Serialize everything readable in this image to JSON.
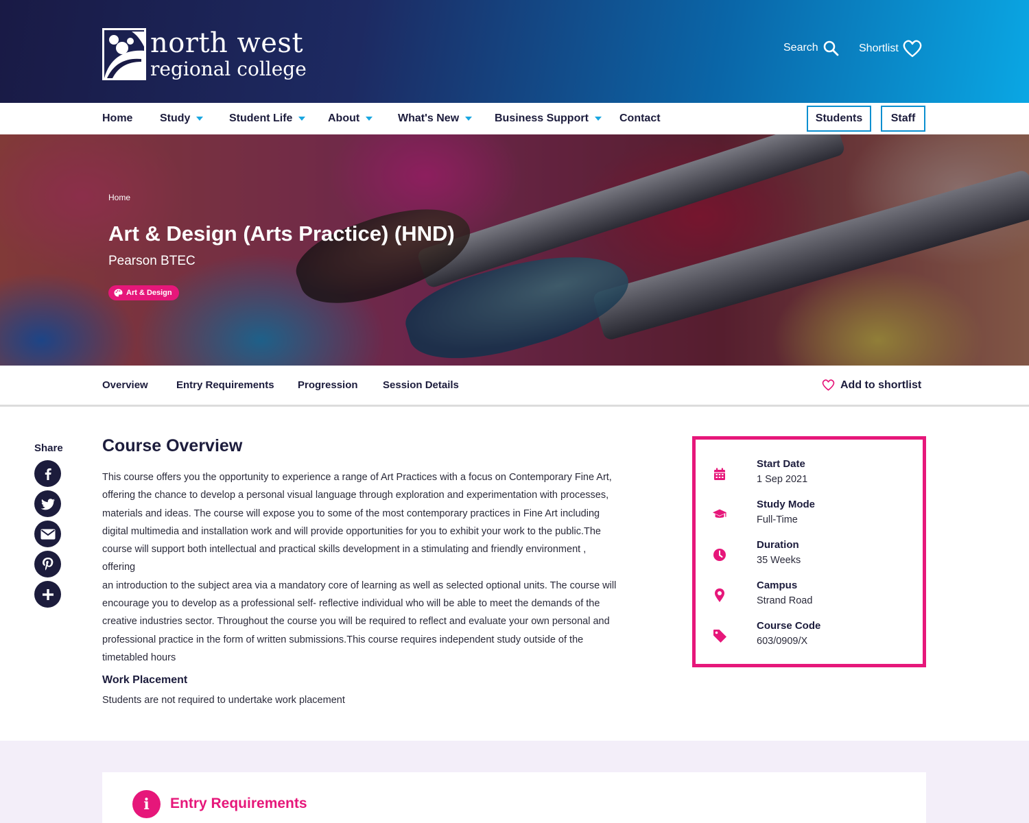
{
  "colors": {
    "header_dark": "#191a45",
    "header_light": "#0aa7e4",
    "accent_pink": "#e6177a",
    "accent_blue": "#0a8fd0",
    "navy_text": "#1c1c3c",
    "bottom_bg": "#f3eef9"
  },
  "header": {
    "logo_line1": "north west",
    "logo_line2": "regional college",
    "search_label": "Search",
    "search_icon": "search-icon",
    "shortlist_label": "Shortlist",
    "shortlist_icon": "heart-icon"
  },
  "nav": {
    "items": [
      {
        "label": "Home",
        "dropdown": false
      },
      {
        "label": "Study",
        "dropdown": true
      },
      {
        "label": "Student Life",
        "dropdown": true
      },
      {
        "label": "About",
        "dropdown": true
      },
      {
        "label": "What's New",
        "dropdown": true
      },
      {
        "label": "Business Support",
        "dropdown": true
      },
      {
        "label": "Contact",
        "dropdown": false
      }
    ],
    "students_button": "Students",
    "staff_button": "Staff"
  },
  "hero": {
    "breadcrumb": "Home",
    "title": "Art & Design (Arts Practice) (HND)",
    "subtitle": "Pearson BTEC",
    "tag": "Art & Design",
    "tag_icon": "palette-icon"
  },
  "tabs": {
    "items": [
      "Overview",
      "Entry Requirements",
      "Progression",
      "Session Details"
    ],
    "add_to_shortlist": "Add to shortlist"
  },
  "share": {
    "label": "Share",
    "buttons": [
      "facebook-icon",
      "twitter-icon",
      "email-icon",
      "pinterest-icon",
      "plus-icon"
    ]
  },
  "overview": {
    "title": "Course Overview",
    "body_lines": [
      "This course offers you the opportunity to experience a range of Art Practices with a focus on Contemporary Fine Art,",
      "offering the chance to develop a personal visual language through exploration and experimentation with processes,",
      "materials and ideas. The course will expose you to some of the most contemporary practices in Fine Art including",
      "digital multimedia and installation work and will provide opportunities for you to exhibit your work to the public.The",
      "course will support both intellectual and practical skills development in a stimulating and friendly environment , offering",
      "an introduction to the subject area via a mandatory core of learning as well as selected optional units. The course will",
      "encourage you to develop as a professional self- reflective individual who will be able to meet the demands of the",
      "creative industries sector. Throughout the course you will be required to reflect and evaluate your own personal and",
      "professional practice in the form of written submissions.This course requires independent study outside of the",
      "timetabled hours"
    ],
    "work_placement_title": "Work Placement",
    "work_placement_body": "Students are not required to undertake work placement"
  },
  "course_info": [
    {
      "icon": "calendar-icon",
      "label": "Start Date",
      "value": "1 Sep 2021"
    },
    {
      "icon": "graduation-cap-icon",
      "label": "Study Mode",
      "value": "Full-Time"
    },
    {
      "icon": "clock-icon",
      "label": "Duration",
      "value": "35 Weeks"
    },
    {
      "icon": "location-pin-icon",
      "label": "Campus",
      "value": "Strand Road"
    },
    {
      "icon": "tag-icon",
      "label": "Course Code",
      "value": "603/0909/X"
    }
  ],
  "entry_requirements": {
    "icon": "info-icon",
    "title": "Entry Requirements"
  }
}
